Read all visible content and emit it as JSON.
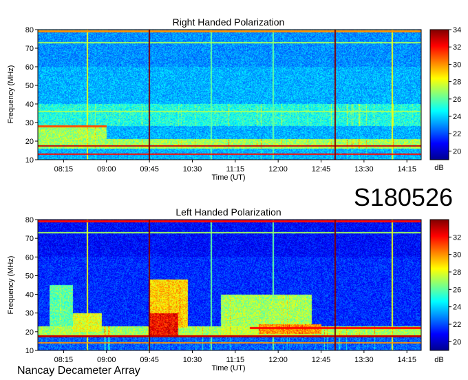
{
  "observation_id": "S180526",
  "footer": "Nancay Decameter Array",
  "chart_data": [
    {
      "type": "heatmap",
      "title": "Right Handed Polarization",
      "xlabel": "Time (UT)",
      "ylabel": "Frequency (MHz)",
      "xlim": [
        "07:48",
        "14:30"
      ],
      "ylim": [
        10,
        80
      ],
      "xticks": [
        "08:15",
        "09:00",
        "09:45",
        "10:30",
        "11:15",
        "12:00",
        "12:45",
        "13:30",
        "14:15"
      ],
      "yticks": [
        10,
        20,
        30,
        40,
        50,
        60,
        70,
        80
      ],
      "colorbar": {
        "label": "dB",
        "range": [
          19,
          34
        ],
        "ticks": [
          20,
          22,
          24,
          26,
          28,
          30,
          32,
          34
        ]
      },
      "colormap": [
        "#00008f",
        "#0000ff",
        "#0080ff",
        "#00ffff",
        "#80ff80",
        "#ffff00",
        "#ff8000",
        "#ff0000",
        "#800000"
      ],
      "background_level_dB": 23.5,
      "features": [
        {
          "kind": "band",
          "f_min": 10,
          "f_max": 16,
          "level_dB": 22
        },
        {
          "kind": "band",
          "f_min": 16,
          "f_max": 21,
          "level_dB": 27
        },
        {
          "kind": "band",
          "f_min": 21,
          "f_max": 28,
          "t_start": "07:48",
          "t_end": "09:00",
          "level_dB": 27
        },
        {
          "kind": "band",
          "f_min": 28,
          "f_max": 40,
          "level_dB": 25
        },
        {
          "kind": "line",
          "freq": 17.5,
          "level_dB": 33
        },
        {
          "kind": "line",
          "freq": 13,
          "level_dB": 32
        },
        {
          "kind": "line",
          "freq": 79,
          "level_dB": 30
        },
        {
          "kind": "line",
          "freq": 73,
          "level_dB": 27
        },
        {
          "kind": "line",
          "freq": 36,
          "level_dB": 27
        },
        {
          "kind": "line",
          "freq": 28,
          "t_start": "07:48",
          "t_end": "09:00",
          "level_dB": 31
        },
        {
          "kind": "vline",
          "time": "08:40",
          "level_dB": 28
        },
        {
          "kind": "vline",
          "time": "09:45",
          "level_dB": 34
        },
        {
          "kind": "vline",
          "time": "10:50",
          "level_dB": 26
        },
        {
          "kind": "vline",
          "time": "11:55",
          "level_dB": 26
        },
        {
          "kind": "vline",
          "time": "13:00",
          "level_dB": 34
        },
        {
          "kind": "vline",
          "time": "14:00",
          "level_dB": 28
        }
      ]
    },
    {
      "type": "heatmap",
      "title": "Left Handed Polarization",
      "xlabel": "Time (UT)",
      "ylabel": "Frequency (MHz)",
      "xlim": [
        "07:48",
        "14:30"
      ],
      "ylim": [
        10,
        80
      ],
      "xticks": [
        "08:15",
        "09:00",
        "09:45",
        "10:30",
        "11:15",
        "12:00",
        "12:45",
        "13:30",
        "14:15"
      ],
      "yticks": [
        10,
        20,
        30,
        40,
        50,
        60,
        70,
        80
      ],
      "colorbar": {
        "label": "dB",
        "range": [
          19,
          34
        ],
        "ticks": [
          20,
          22,
          24,
          26,
          28,
          30,
          32
        ]
      },
      "colormap": [
        "#00008f",
        "#0000ff",
        "#0080ff",
        "#00ffff",
        "#80ff80",
        "#ffff00",
        "#ff8000",
        "#ff0000",
        "#800000"
      ],
      "background_level_dB": 21.5,
      "features": [
        {
          "kind": "band",
          "f_min": 10,
          "f_max": 17,
          "level_dB": 22
        },
        {
          "kind": "band",
          "f_min": 17,
          "f_max": 23,
          "level_dB": 27
        },
        {
          "kind": "band",
          "f_min": 22,
          "f_max": 48,
          "t_start": "09:45",
          "t_end": "10:25",
          "level_dB": 29
        },
        {
          "kind": "band",
          "f_min": 17,
          "f_max": 30,
          "t_start": "09:45",
          "t_end": "10:15",
          "level_dB": 32
        },
        {
          "kind": "band",
          "f_min": 18,
          "f_max": 40,
          "t_start": "11:00",
          "t_end": "12:35",
          "level_dB": 27
        },
        {
          "kind": "band",
          "f_min": 19,
          "f_max": 24,
          "t_start": "11:40",
          "t_end": "12:45",
          "level_dB": 30
        },
        {
          "kind": "band",
          "f_min": 17,
          "f_max": 45,
          "t_start": "08:00",
          "t_end": "08:25",
          "level_dB": 26
        },
        {
          "kind": "band",
          "f_min": 20,
          "f_max": 30,
          "t_start": "08:25",
          "t_end": "08:55",
          "level_dB": 28
        },
        {
          "kind": "line",
          "freq": 17.5,
          "level_dB": 33
        },
        {
          "kind": "line",
          "freq": 14,
          "level_dB": 30
        },
        {
          "kind": "line",
          "freq": 79,
          "level_dB": 32
        },
        {
          "kind": "line",
          "freq": 73,
          "level_dB": 27
        },
        {
          "kind": "line",
          "freq": 22,
          "t_start": "11:30",
          "t_end": "14:30",
          "level_dB": 32
        },
        {
          "kind": "vline",
          "time": "08:40",
          "level_dB": 28
        },
        {
          "kind": "vline",
          "time": "09:45",
          "level_dB": 34
        },
        {
          "kind": "vline",
          "time": "10:50",
          "level_dB": 26
        },
        {
          "kind": "vline",
          "time": "11:55",
          "level_dB": 26
        },
        {
          "kind": "vline",
          "time": "13:00",
          "level_dB": 34
        },
        {
          "kind": "vline",
          "time": "14:00",
          "level_dB": 28
        }
      ]
    }
  ]
}
